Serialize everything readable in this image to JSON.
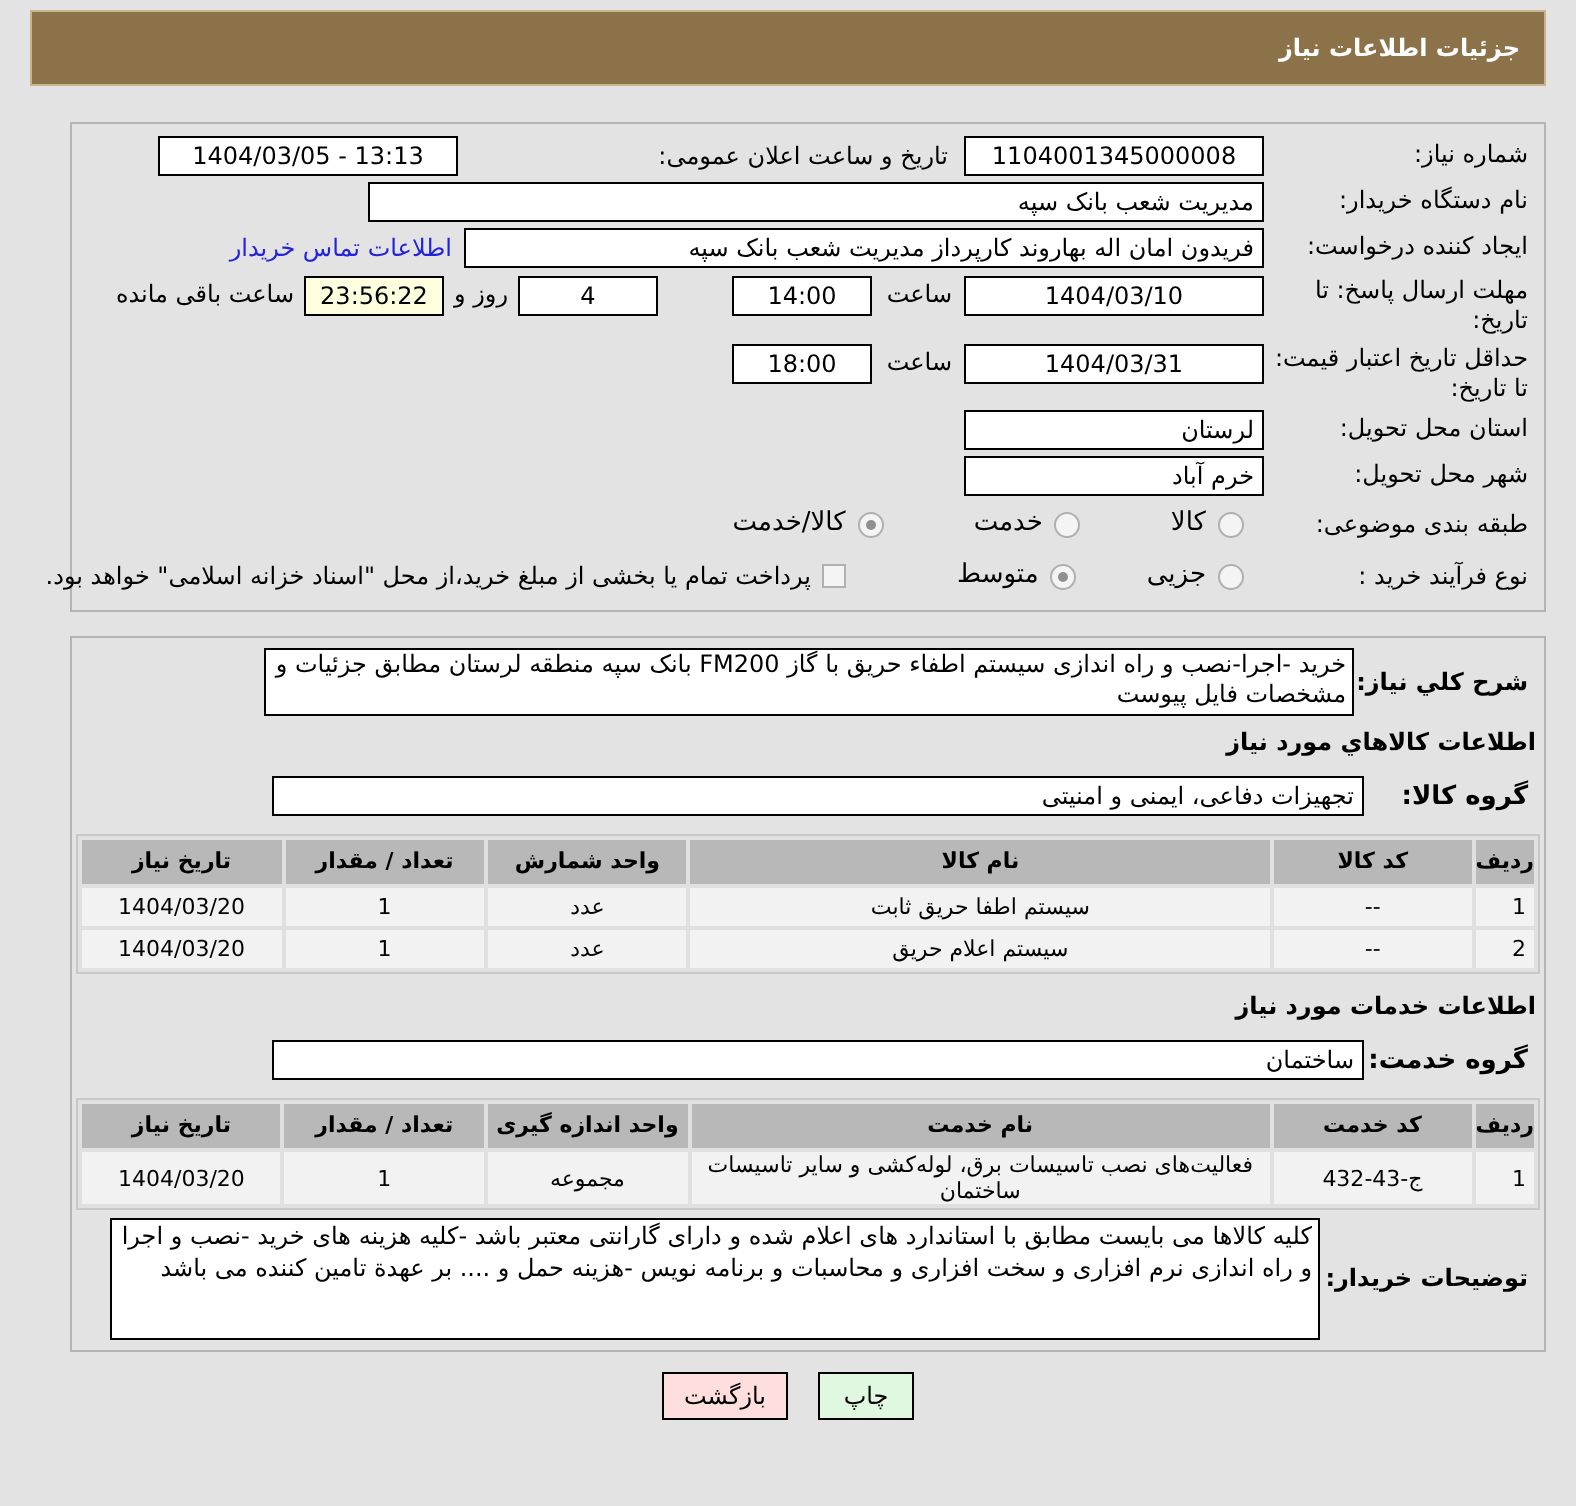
{
  "header": {
    "title": "جزئیات اطلاعات نیاز"
  },
  "need_number": {
    "label": "شماره نیاز:",
    "value": "1104001345000008"
  },
  "announce": {
    "label": "تاریخ و ساعت اعلان عمومی:",
    "value": "1404/03/05 - 13:13"
  },
  "buyer_org": {
    "label": "نام دستگاه خریدار:",
    "value": "مدیریت شعب بانک سپه"
  },
  "requester": {
    "label": "ایجاد کننده درخواست:",
    "value": "فریدون امان اله بهاروند کارپرداز مدیریت شعب بانک سپه",
    "link": "اطلاعات تماس خریدار"
  },
  "reply_deadline": {
    "label": "مهلت ارسال پاسخ: تا تاریخ:",
    "date": "1404/03/10",
    "time_label": "ساعت",
    "time": "14:00",
    "days": "4",
    "days_label": "روز و",
    "remaining": "23:56:22",
    "remaining_label": "ساعت باقی مانده"
  },
  "price_validity": {
    "label": "حداقل تاریخ اعتبار قیمت: تا تاریخ:",
    "date": "1404/03/31",
    "time_label": "ساعت",
    "time": "18:00"
  },
  "province": {
    "label": "استان محل تحویل:",
    "value": "لرستان"
  },
  "city": {
    "label": "شهر محل تحویل:",
    "value": "خرم آباد"
  },
  "category": {
    "label": "طبقه بندی موضوعی:",
    "options": [
      {
        "label": "کالا",
        "selected": false
      },
      {
        "label": "خدمت",
        "selected": false
      },
      {
        "label": "کالا/خدمت",
        "selected": true
      }
    ]
  },
  "process": {
    "label": "نوع فرآیند خرید :",
    "options": [
      {
        "label": "جزیی",
        "selected": false
      },
      {
        "label": "متوسط",
        "selected": true
      }
    ],
    "treasury": {
      "label": "پرداخت تمام یا بخشی از مبلغ خرید،از محل \"اسناد خزانه اسلامی\" خواهد بود.",
      "checked": false
    }
  },
  "description": {
    "label": "شرح کلي نیاز:",
    "value": "خرید -اجرا-نصب و راه اندازی سیستم اطفاء حریق با گاز FM200 بانک سپه منطقه لرستان مطابق جزئیات و مشخصات فایل پیوست"
  },
  "goods": {
    "heading": "اطلاعات کالاهاي مورد نیاز",
    "group_label": "گروه کالا:",
    "group": "تجهیزات دفاعی، ایمنی و امنیتی",
    "columns": [
      "ردیف",
      "کد کالا",
      "نام کالا",
      "واحد شمارش",
      "تعداد / مقدار",
      "تاریخ نیاز"
    ],
    "rows": [
      [
        "1",
        "--",
        "سیستم اطفا حریق ثابت",
        "عدد",
        "1",
        "1404/03/20"
      ],
      [
        "2",
        "--",
        "سیستم اعلام حریق",
        "عدد",
        "1",
        "1404/03/20"
      ]
    ]
  },
  "services": {
    "heading": "اطلاعات خدمات مورد نیاز",
    "group_label": "گروه خدمت:",
    "group": "ساختمان",
    "columns": [
      "ردیف",
      "کد خدمت",
      "نام خدمت",
      "واحد اندازه گیری",
      "تعداد / مقدار",
      "تاریخ نیاز"
    ],
    "rows": [
      [
        "1",
        "ج-43-432",
        "فعالیت‌های نصب تاسیسات برق، لوله‌کشی و سایر تاسیسات ساختمان",
        "مجموعه",
        "1",
        "1404/03/20"
      ]
    ]
  },
  "buyer_notes": {
    "label": "توضیحات خریدار:",
    "value": "کلیه کالاها می بایست مطابق با استاندارد های اعلام شده و دارای گارانتی معتبر باشد -کلیه هزینه های خرید -نصب و اجرا و راه اندازی نرم افزاری و سخت افزاری و محاسبات و برنامه نویس -هزینه حمل و .... بر عهدة تامین کننده می باشد"
  },
  "buttons": [
    {
      "label": "چاپ",
      "kind": "print"
    },
    {
      "label": "بازگشت",
      "kind": "back"
    }
  ]
}
